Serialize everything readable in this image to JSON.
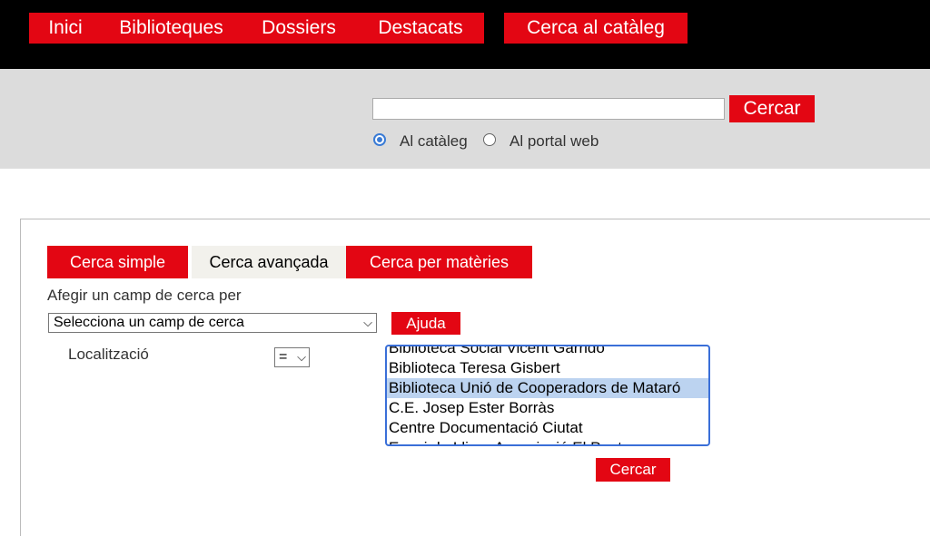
{
  "nav": {
    "items": [
      "Inici",
      "Biblioteques",
      "Dossiers",
      "Destacats"
    ],
    "catalog_button": "Cerca al catàleg"
  },
  "top_search": {
    "value": "",
    "button": "Cercar",
    "options": [
      "Al catàleg",
      "Al portal web"
    ],
    "selected": "Al catàleg"
  },
  "tabs": [
    "Cerca simple",
    "Cerca avançada",
    "Cerca per matèries"
  ],
  "active_tab": "Cerca avançada",
  "advanced": {
    "add_field_label": "Afegir un camp de cerca per",
    "field_select": "Selecciona un camp de cerca",
    "help_button": "Ajuda",
    "location_label": "Localització",
    "operator": "=",
    "libraries": [
      "Biblioteca Social Vicent Garrido",
      "Biblioteca Teresa Gisbert",
      "Biblioteca Unió de Cooperadors de Mataró",
      "C.E. Josep Ester Borràs",
      "Centre Documentació Ciutat",
      "Espai de Lliure Associació El Punt"
    ],
    "selected_library": "Biblioteca Unió de Cooperadors de Mataró",
    "search_button": "Cercar"
  },
  "colors": {
    "accent": "#e30613",
    "header_bg": "#000000",
    "band_bg": "#dcdcdc",
    "focus": "#3a6fd8"
  }
}
